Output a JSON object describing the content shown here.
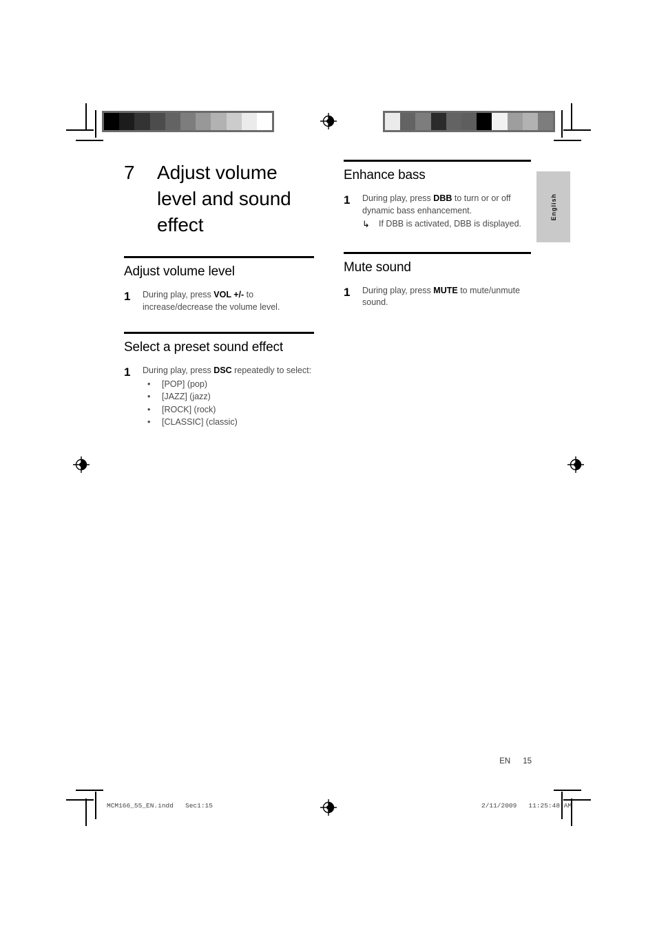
{
  "document": {
    "page_number": "15",
    "language_tab": "English",
    "locale_code": "EN"
  },
  "chapter": {
    "number": "7",
    "title": "Adjust volume level and sound effect"
  },
  "sections": {
    "adjust_volume": {
      "title": "Adjust volume level",
      "step_number": "1",
      "text_before": "During play, press ",
      "key": "VOL +/-",
      "text_after": " to increase/decrease the volume level."
    },
    "preset_effect": {
      "title": "Select a preset sound effect",
      "step_number": "1",
      "text_before": "During play, press ",
      "key": "DSC",
      "text_after": " repeatedly to select:",
      "bullet_glyph": "•",
      "options": [
        "[POP] (pop)",
        "[JAZZ] (jazz)",
        "[ROCK] (rock)",
        "[CLASSIC] (classic)"
      ]
    },
    "enhance_bass": {
      "title": "Enhance bass",
      "step_number": "1",
      "text_before": "During play, press ",
      "key": "DBB",
      "text_after": " to turn or or off dynamic bass enhancement.",
      "arrow_glyph": "↳",
      "result": "If DBB is activated, DBB is displayed."
    },
    "mute_sound": {
      "title": "Mute sound",
      "step_number": "1",
      "text_before": "During play, press ",
      "key": "MUTE",
      "text_after": " to mute/unmute sound."
    }
  },
  "footer": {
    "file_name": "MCM166_55_EN.indd",
    "section_marker": "Sec1:15",
    "date": "2/11/2009",
    "time": "11:25:48 AM"
  },
  "calibration": {
    "left_bar_colors": [
      "#000000",
      "#1c1c1c",
      "#333333",
      "#4c4c4c",
      "#636363",
      "#7d7d7d",
      "#989898",
      "#b2b2b2",
      "#cccccc",
      "#ebebeb",
      "#ffffff"
    ],
    "right_bar_colors": [
      "#ebebeb",
      "#636363",
      "#7d7d7d",
      "#2b2b2b",
      "#636363",
      "#5e5e5e",
      "#000000",
      "#f2f2f2",
      "#9e9e9e",
      "#b2b2b2",
      "#7d7d7d"
    ],
    "border_color": "#6b6b6b"
  }
}
